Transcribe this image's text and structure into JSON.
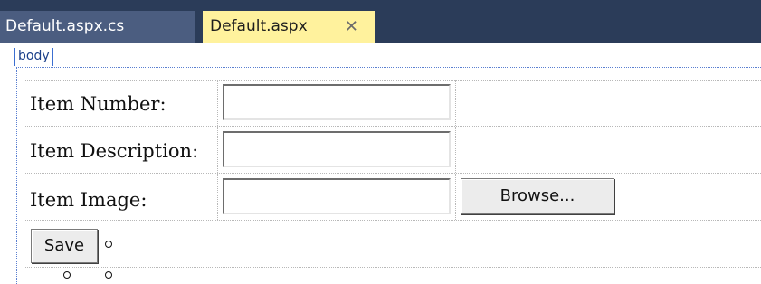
{
  "tabs": [
    {
      "label": "Default.aspx.cs",
      "active": false
    },
    {
      "label": "Default.aspx",
      "active": true,
      "close": "✕"
    }
  ],
  "designer": {
    "tag": "body"
  },
  "form": {
    "item_number_label": "Item Number:",
    "item_description_label": "Item Description:",
    "item_image_label": "Item Image:",
    "item_number_value": "",
    "item_description_value": "",
    "item_image_value": "",
    "browse_label": "Browse...",
    "save_label": "Save"
  },
  "colors": {
    "tabstrip": "#2b3c59",
    "active_tab": "#fff29d",
    "inactive_tab": "#4b5d80",
    "selection_outline": "#3c6fd1"
  }
}
